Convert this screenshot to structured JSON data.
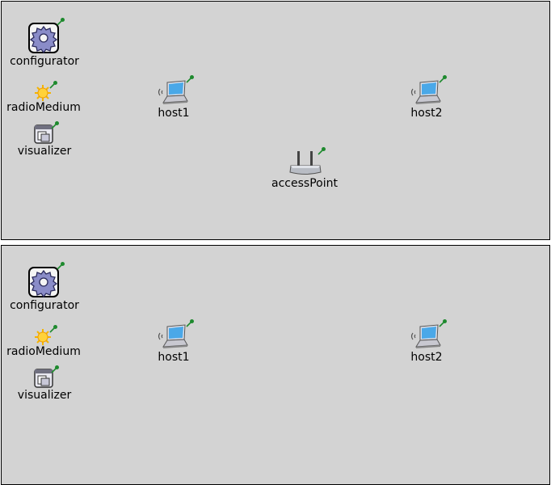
{
  "top": {
    "configurator_label": "configurator",
    "radio_label": "radioMedium",
    "visualizer_label": "visualizer",
    "host1_label": "host1",
    "host2_label": "host2",
    "ap_label": "accessPoint"
  },
  "bottom": {
    "configurator_label": "configurator",
    "radio_label": "radioMedium",
    "visualizer_label": "visualizer",
    "host1_label": "host1",
    "host2_label": "host2"
  },
  "colors": {
    "canvas": "#d3d3d3",
    "pin": "#1e8a2e",
    "laptop_screen": "#4aa8e8",
    "sun": "#f5b400",
    "gear": "#8a8cc8"
  }
}
